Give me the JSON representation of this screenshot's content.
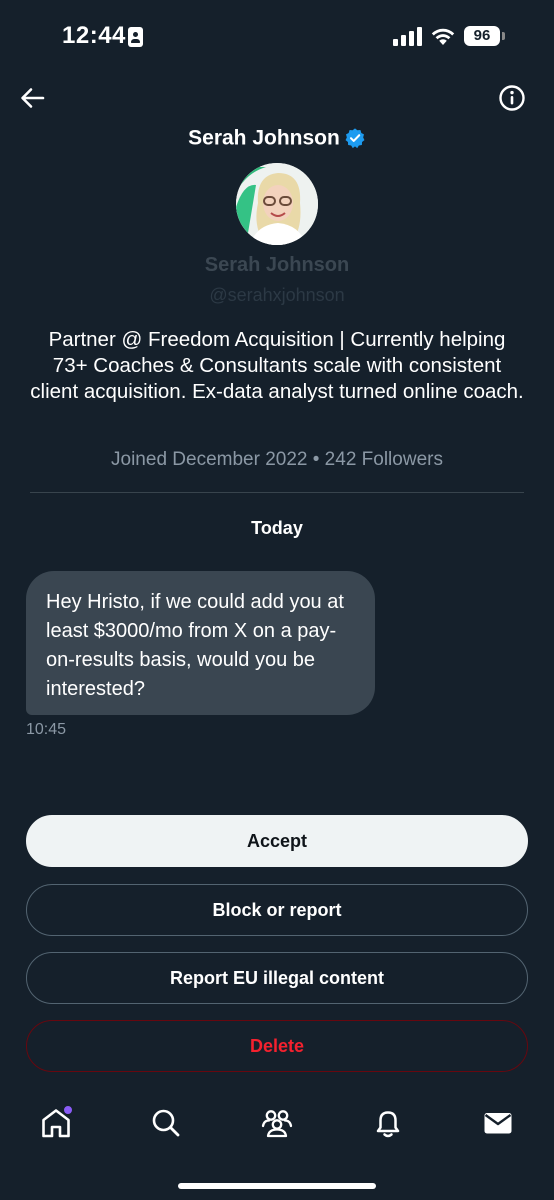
{
  "status_bar": {
    "time": "12:44",
    "battery": "96"
  },
  "header": {
    "name": "Serah Johnson"
  },
  "profile": {
    "name": "Serah Johnson",
    "handle": "@serahxjohnson",
    "bio": "Partner @ Freedom Acquisition | Currently helping 73+ Coaches & Consultants scale with consistent client acquisition. Ex-data analyst turned online coach.",
    "joined": "Joined December 2022 • 242 Followers"
  },
  "conversation": {
    "day_label": "Today",
    "message": {
      "text": "Hey Hristo, if we could add you at least $3000/mo from X on a pay-on-results basis, would you be interested?",
      "time": "10:45"
    }
  },
  "actions": {
    "accept": "Accept",
    "block": "Block or report",
    "report_eu": "Report EU illegal content",
    "delete": "Delete"
  },
  "tabs": [
    "home-icon",
    "search-icon",
    "communities-icon",
    "notifications-icon",
    "messages-icon"
  ],
  "colors": {
    "background": "#15202b",
    "bubble": "#3a4651",
    "verified": "#1d9bf0",
    "delete": "#f4212e",
    "muted": "#8b98a5"
  }
}
